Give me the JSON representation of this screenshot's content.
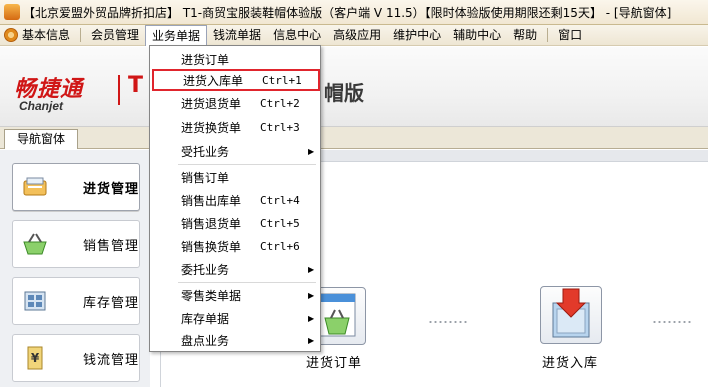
{
  "window": {
    "title": "【北京爱盟外贸品牌折扣店】 T1-商贸宝服装鞋帽体验版（客户端 V 11.5）【限时体验版使用期限还剩15天】 - [导航窗体]"
  },
  "menubar": {
    "items": [
      {
        "label": "基本信息"
      },
      {
        "label": "会员管理"
      },
      {
        "label": "业务单据"
      },
      {
        "label": "钱流单据"
      },
      {
        "label": "信息中心"
      },
      {
        "label": "高级应用"
      },
      {
        "label": "维护中心"
      },
      {
        "label": "辅助中心"
      },
      {
        "label": "帮助"
      },
      {
        "label": "窗口"
      }
    ]
  },
  "banner": {
    "logo_text": "畅捷通",
    "logo_sub": "Chanjet",
    "logo_t": "T",
    "product_suffix": "帽版"
  },
  "tabs": {
    "nav_tab": "导航窗体"
  },
  "nav": [
    {
      "label": "进货管理",
      "icon": "purchase-icon",
      "selected": true
    },
    {
      "label": "销售管理",
      "icon": "basket-icon",
      "selected": false
    },
    {
      "label": "库存管理",
      "icon": "inventory-icon",
      "selected": false
    },
    {
      "label": "钱流管理",
      "icon": "money-icon",
      "selected": false
    }
  ],
  "workflow": {
    "purchase_order": "进货订单",
    "purchase_in": "进货入库"
  },
  "dropdown": {
    "items": [
      {
        "label": "进货订单",
        "shortcut": "",
        "submenu": false
      },
      {
        "label": "进货入库单",
        "shortcut": "Ctrl+1",
        "submenu": false
      },
      {
        "label": "进货退货单",
        "shortcut": "Ctrl+2",
        "submenu": false
      },
      {
        "label": "进货换货单",
        "shortcut": "Ctrl+3",
        "submenu": false
      },
      {
        "label": "受托业务",
        "shortcut": "",
        "submenu": true
      },
      {
        "label": "销售订单",
        "shortcut": "",
        "submenu": false
      },
      {
        "label": "销售出库单",
        "shortcut": "Ctrl+4",
        "submenu": false
      },
      {
        "label": "销售退货单",
        "shortcut": "Ctrl+5",
        "submenu": false
      },
      {
        "label": "销售换货单",
        "shortcut": "Ctrl+6",
        "submenu": false
      },
      {
        "label": "委托业务",
        "shortcut": "",
        "submenu": true
      },
      {
        "label": "零售类单据",
        "shortcut": "",
        "submenu": true
      },
      {
        "label": "库存单据",
        "shortcut": "",
        "submenu": true
      },
      {
        "label": "盘点业务",
        "shortcut": "",
        "submenu": true
      }
    ],
    "highlighted_index": 1
  },
  "colors": {
    "highlight_border": "#e0252d",
    "brand_red": "#d01616"
  }
}
